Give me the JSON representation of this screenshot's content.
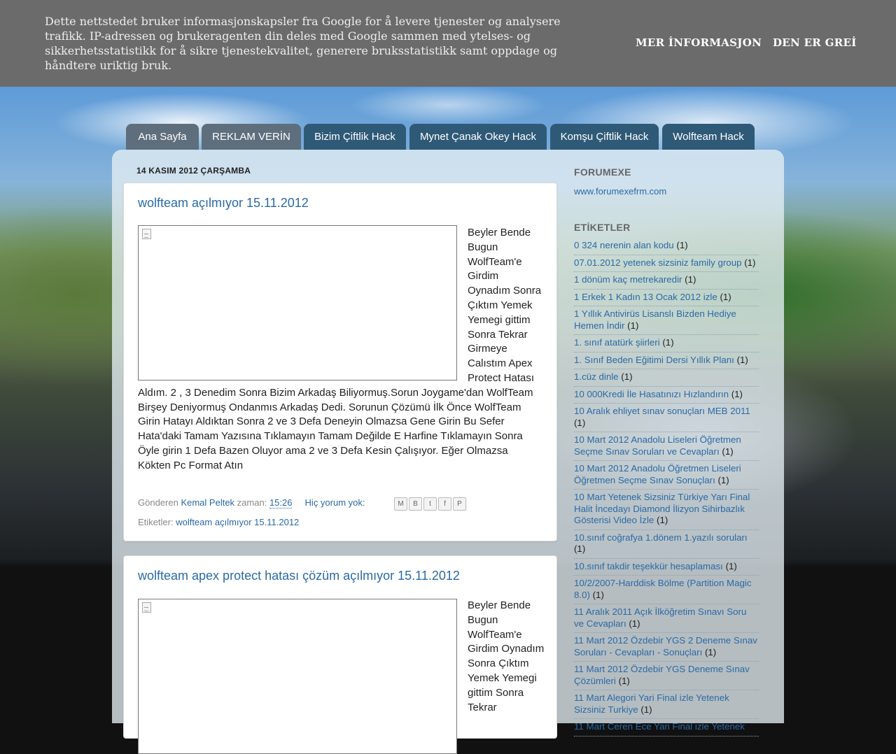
{
  "cookie": {
    "text": "Dette nettstedet bruker informasjonskapsler fra Google for å levere tjenester og analysere trafikk. IP-adressen og brukeragenten din deles med Google sammen med ytelses- og sikkerhetsstatistikk for å sikre tjenestekvalitet, generere bruksstatistikk samt oppdage og håndtere uriktig bruk.",
    "more_info": "MER İNFORMASJON",
    "ok": "DEN ER GREİ"
  },
  "tabs": [
    {
      "label": "Ana Sayfa"
    },
    {
      "label": "REKLAM VERİN"
    },
    {
      "label": "Bizim Çiftlik Hack"
    },
    {
      "label": "Mynet Çanak Okey Hack"
    },
    {
      "label": "Komşu Çiftlik Hack"
    },
    {
      "label": "Wolfteam Hack"
    }
  ],
  "date_header": "14 KASIM 2012 ÇARŞAMBA",
  "posts": [
    {
      "title": "wolfteam açılmıyor 15.11.2012",
      "body": "Beyler Bende Bugun WolfTeam'e Girdim Oynadım Sonra Çıktım Yemek Yemegi gittim Sonra Tekrar Girmeye Calıstım Apex Protect Hatası Aldım. 2 , 3 Denedim Sonra Bizim Arkadaş Biliyormuş.Sorun Joygame'dan WolfTeam Birşey Deniyormuş Ondanmıs Arkadaş Dedi. Sorunun Çözümü İlk Önce WolfTeam Girin Hatayı Aldıktan Sonra 2 ve 3 Defa Deneyin Olmazsa Gene Girin Bu Sefer Hata'daki Tamam Yazısına Tıklamayın Tamam Değilde E Harfine Tıklamayın Sonra Öyle girin 1 Defa Bazen Oluyor ama 2 ve 3 Defa Kesin Çalışıyor. Eğer Olmazsa Kökten Pc Format Atın",
      "posted_by_label": "Gönderen",
      "author": "Kemal Peltek",
      "time_label": "zaman:",
      "time": "15:26",
      "comments": "Hiç yorum yok:",
      "labels_label": "Etiketler:",
      "label": "wolfteam açılmıyor 15.11.2012"
    },
    {
      "title": "wolfteam apex protect hatası çözüm açılmıyor 15.11.2012",
      "body": "Beyler Bende Bugun WolfTeam'e Girdim Oynadım Sonra Çıktım Yemek Yemegi gittim Sonra Tekrar"
    }
  ],
  "share_icons": [
    "M",
    "B",
    "t",
    "f",
    "P"
  ],
  "sidebar": {
    "forumexe_heading": "FORUMEXE",
    "forumexe_link": "www.forumexefrm.com",
    "labels_heading": "ETİKETLER",
    "labels": [
      {
        "name": "0 324 nerenin alan kodu",
        "count": "(1)"
      },
      {
        "name": "07.01.2012 yetenek sizsiniz family group",
        "count": "(1)"
      },
      {
        "name": "1 dönüm kaç metrekaredir",
        "count": "(1)"
      },
      {
        "name": "1 Erkek 1 Kadın 13 Ocak 2012 izle",
        "count": "(1)"
      },
      {
        "name": "1 Yıllık Antivirüs Lisanslı Bizden Hediye Hemen İndir",
        "count": "(1)"
      },
      {
        "name": "1. sınıf atatürk şiirleri",
        "count": "(1)"
      },
      {
        "name": "1. Sınıf Beden Eğitimi Dersi Yıllık Planı",
        "count": "(1)"
      },
      {
        "name": "1.cüz dinle",
        "count": "(1)"
      },
      {
        "name": "10 000Kredi İle Hasatınızı Hızlandırın",
        "count": "(1)"
      },
      {
        "name": "10 Aralık ehliyet sınav sonuçları MEB 2011",
        "count": "(1)"
      },
      {
        "name": "10 Mart 2012 Anadolu Liseleri Öğretmen Seçme Sınav Soruları ve Cevapları",
        "count": "(1)"
      },
      {
        "name": "10 Mart 2012 Anadolu Öğretmen Liseleri Öğretmen Seçme Sınav Sonuçları",
        "count": "(1)"
      },
      {
        "name": "10 Mart Yetenek Sizsiniz Türkiye Yarı Final Halit İncedayı Diamond İlizyon Sihirbazlık Gösterisi Video İzle",
        "count": "(1)"
      },
      {
        "name": "10.sınıf coğrafya 1.dönem 1.yazılı soruları",
        "count": "(1)"
      },
      {
        "name": "10.sınıf takdir teşekkür hesaplaması",
        "count": "(1)"
      },
      {
        "name": "10/2/2007-Harddisk Bölme (Partition Magic 8.0)",
        "count": "(1)"
      },
      {
        "name": "11 Aralık 2011 Açık İlköğretim Sınavı Soru ve Cevapları",
        "count": "(1)"
      },
      {
        "name": "11 Mart 2012 Özdebir YGS 2 Deneme Sınav Soruları - Cevapları - Sonuçları",
        "count": "(1)"
      },
      {
        "name": "11 Mart 2012 Özdebir YGS Deneme Sınav Çözümleri",
        "count": "(1)"
      },
      {
        "name": "11 Mart Alegori Yari Final izle Yetenek Sizsiniz Turkiye",
        "count": "(1)"
      },
      {
        "name": "11 Mart Ceren Ece Yari Final izle Yetenek",
        "count": ""
      }
    ]
  }
}
